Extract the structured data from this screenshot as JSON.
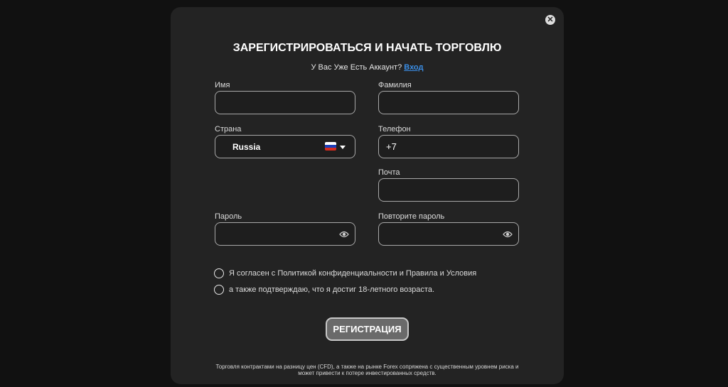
{
  "modal": {
    "title": "ЗАРЕГИСТРИРОВАТЬСЯ И НАЧАТЬ ТОРГОВЛЮ",
    "have_account_text": "У Вас Уже Есть Аккаунт?",
    "login_link": "Вход",
    "close_icon": "close-icon"
  },
  "form": {
    "first_name": {
      "label": "Имя",
      "value": ""
    },
    "last_name": {
      "label": "Фамилия",
      "value": ""
    },
    "country": {
      "label": "Страна",
      "value": "Russia",
      "flag_icon": "russia-flag-icon"
    },
    "phone": {
      "label": "Телефон",
      "value": "+7"
    },
    "email": {
      "label": "Почта",
      "value": ""
    },
    "password": {
      "label": "Пароль",
      "value": "",
      "icon": "eye-icon"
    },
    "confirm_password": {
      "label": "Повторите пароль",
      "value": "",
      "icon": "eye-icon"
    }
  },
  "agreements": [
    "Я согласен с Политикой конфиденциальности и Правила и Условия",
    "а также подтверждаю, что я достиг 18-летного возраста."
  ],
  "register_button": "РЕГИСТРАЦИЯ",
  "disclaimer": "Торговля контрактами на разницу цен (CFD), а также на рынке Forex сопряжена с существенным уровнем риска и может привести к потере инвестированных средств.",
  "colors": {
    "background": "#111111",
    "modal": "#232323",
    "link": "#3a8ee6",
    "button": "#6a6a6a"
  }
}
